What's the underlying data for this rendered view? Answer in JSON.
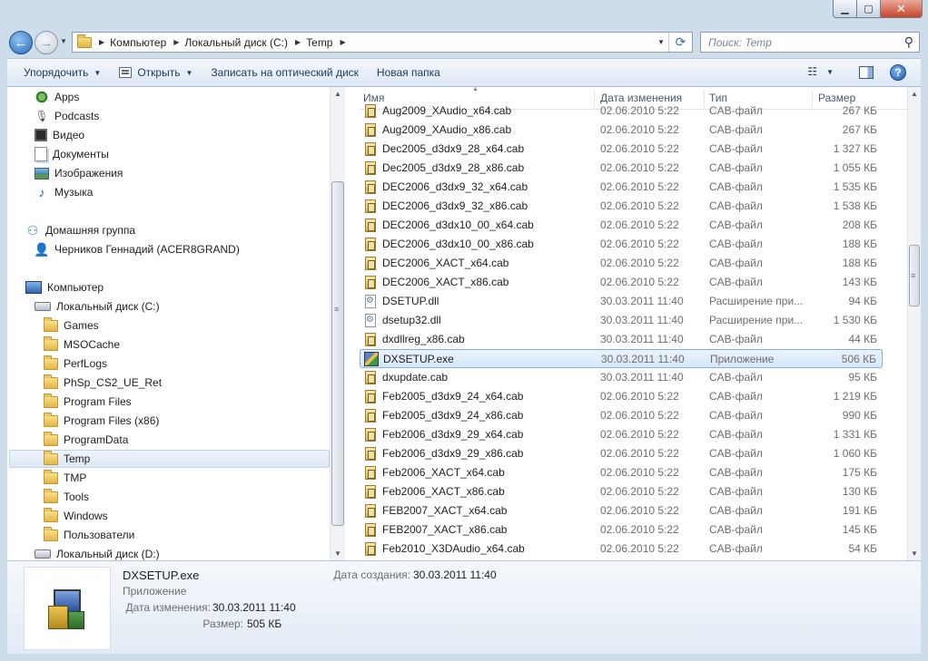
{
  "window": {
    "min_glyph": "▁",
    "max_glyph": "▢",
    "close_glyph": "✕"
  },
  "address": {
    "crumbs": [
      "Компьютер",
      "Локальный диск (C:)",
      "Temp"
    ],
    "sep_glyph": "▶",
    "search_placeholder": "Поиск: Temp"
  },
  "toolbar": {
    "organize": "Упорядочить",
    "open": "Открыть",
    "burn": "Записать на оптический диск",
    "new_folder": "Новая папка"
  },
  "nav": {
    "items": [
      {
        "label": "Apps",
        "icon": "apps-icon"
      },
      {
        "label": "Podcasts",
        "icon": "podcasts-icon"
      },
      {
        "label": "Видео",
        "icon": "video-icon"
      },
      {
        "label": "Документы",
        "icon": "documents-icon"
      },
      {
        "label": "Изображения",
        "icon": "pictures-icon"
      },
      {
        "label": "Музыка",
        "icon": "music-icon"
      },
      {
        "label": "Домашняя группа",
        "icon": "homegroup-icon"
      },
      {
        "label": "Черников Геннадий (ACER8GRAND)",
        "icon": "user-icon"
      },
      {
        "label": "Компьютер",
        "icon": "computer-icon"
      },
      {
        "label": "Локальный диск (C:)",
        "icon": "drive-icon"
      },
      {
        "label": "Games",
        "icon": "folder-icon"
      },
      {
        "label": "MSOCache",
        "icon": "folder-icon"
      },
      {
        "label": "PerfLogs",
        "icon": "folder-icon"
      },
      {
        "label": "PhSp_CS2_UE_Ret",
        "icon": "folder-icon"
      },
      {
        "label": "Program Files",
        "icon": "folder-icon"
      },
      {
        "label": "Program Files (x86)",
        "icon": "folder-icon"
      },
      {
        "label": "ProgramData",
        "icon": "folder-icon"
      },
      {
        "label": "Temp",
        "icon": "folder-icon"
      },
      {
        "label": "TMP",
        "icon": "folder-icon"
      },
      {
        "label": "Tools",
        "icon": "folder-icon"
      },
      {
        "label": "Windows",
        "icon": "folder-icon"
      },
      {
        "label": "Пользователи",
        "icon": "folder-icon"
      },
      {
        "label": "Локальный диск (D:)",
        "icon": "drive-icon"
      }
    ]
  },
  "columns": {
    "name": "Имя",
    "date": "Дата изменения",
    "type": "Тип",
    "size": "Размер"
  },
  "files": [
    {
      "name": "Aug2009_XAudio_x64.cab",
      "date": "02.06.2010 5:22",
      "type": "CAB-файл",
      "size": "267 КБ",
      "kind": "cab"
    },
    {
      "name": "Aug2009_XAudio_x86.cab",
      "date": "02.06.2010 5:22",
      "type": "CAB-файл",
      "size": "267 КБ",
      "kind": "cab"
    },
    {
      "name": "Dec2005_d3dx9_28_x64.cab",
      "date": "02.06.2010 5:22",
      "type": "CAB-файл",
      "size": "1 327 КБ",
      "kind": "cab"
    },
    {
      "name": "Dec2005_d3dx9_28_x86.cab",
      "date": "02.06.2010 5:22",
      "type": "CAB-файл",
      "size": "1 055 КБ",
      "kind": "cab"
    },
    {
      "name": "DEC2006_d3dx9_32_x64.cab",
      "date": "02.06.2010 5:22",
      "type": "CAB-файл",
      "size": "1 535 КБ",
      "kind": "cab"
    },
    {
      "name": "DEC2006_d3dx9_32_x86.cab",
      "date": "02.06.2010 5:22",
      "type": "CAB-файл",
      "size": "1 538 КБ",
      "kind": "cab"
    },
    {
      "name": "DEC2006_d3dx10_00_x64.cab",
      "date": "02.06.2010 5:22",
      "type": "CAB-файл",
      "size": "208 КБ",
      "kind": "cab"
    },
    {
      "name": "DEC2006_d3dx10_00_x86.cab",
      "date": "02.06.2010 5:22",
      "type": "CAB-файл",
      "size": "188 КБ",
      "kind": "cab"
    },
    {
      "name": "DEC2006_XACT_x64.cab",
      "date": "02.06.2010 5:22",
      "type": "CAB-файл",
      "size": "188 КБ",
      "kind": "cab"
    },
    {
      "name": "DEC2006_XACT_x86.cab",
      "date": "02.06.2010 5:22",
      "type": "CAB-файл",
      "size": "143 КБ",
      "kind": "cab"
    },
    {
      "name": "DSETUP.dll",
      "date": "30.03.2011 11:40",
      "type": "Расширение при...",
      "size": "94 КБ",
      "kind": "dll"
    },
    {
      "name": "dsetup32.dll",
      "date": "30.03.2011 11:40",
      "type": "Расширение при...",
      "size": "1 530 КБ",
      "kind": "dll"
    },
    {
      "name": "dxdllreg_x86.cab",
      "date": "30.03.2011 11:40",
      "type": "CAB-файл",
      "size": "44 КБ",
      "kind": "cab"
    },
    {
      "name": "DXSETUP.exe",
      "date": "30.03.2011 11:40",
      "type": "Приложение",
      "size": "506 КБ",
      "kind": "exe",
      "selected": true
    },
    {
      "name": "dxupdate.cab",
      "date": "30.03.2011 11:40",
      "type": "CAB-файл",
      "size": "95 КБ",
      "kind": "cab"
    },
    {
      "name": "Feb2005_d3dx9_24_x64.cab",
      "date": "02.06.2010 5:22",
      "type": "CAB-файл",
      "size": "1 219 КБ",
      "kind": "cab"
    },
    {
      "name": "Feb2005_d3dx9_24_x86.cab",
      "date": "02.06.2010 5:22",
      "type": "CAB-файл",
      "size": "990 КБ",
      "kind": "cab"
    },
    {
      "name": "Feb2006_d3dx9_29_x64.cab",
      "date": "02.06.2010 5:22",
      "type": "CAB-файл",
      "size": "1 331 КБ",
      "kind": "cab"
    },
    {
      "name": "Feb2006_d3dx9_29_x86.cab",
      "date": "02.06.2010 5:22",
      "type": "CAB-файл",
      "size": "1 060 КБ",
      "kind": "cab"
    },
    {
      "name": "Feb2006_XACT_x64.cab",
      "date": "02.06.2010 5:22",
      "type": "CAB-файл",
      "size": "175 КБ",
      "kind": "cab"
    },
    {
      "name": "Feb2006_XACT_x86.cab",
      "date": "02.06.2010 5:22",
      "type": "CAB-файл",
      "size": "130 КБ",
      "kind": "cab"
    },
    {
      "name": "FEB2007_XACT_x64.cab",
      "date": "02.06.2010 5:22",
      "type": "CAB-файл",
      "size": "191 КБ",
      "kind": "cab"
    },
    {
      "name": "FEB2007_XACT_x86.cab",
      "date": "02.06.2010 5:22",
      "type": "CAB-файл",
      "size": "145 КБ",
      "kind": "cab"
    },
    {
      "name": "Feb2010_X3DAudio_x64.cab",
      "date": "02.06.2010 5:22",
      "type": "CAB-файл",
      "size": "54 КБ",
      "kind": "cab"
    }
  ],
  "details": {
    "name": "DXSETUP.exe",
    "type": "Приложение",
    "modified_label": "Дата изменения:",
    "modified_value": "30.03.2011 11:40",
    "size_label": "Размер:",
    "size_value": "505 КБ",
    "created_label": "Дата создания:",
    "created_value": "30.03.2011 11:40"
  }
}
